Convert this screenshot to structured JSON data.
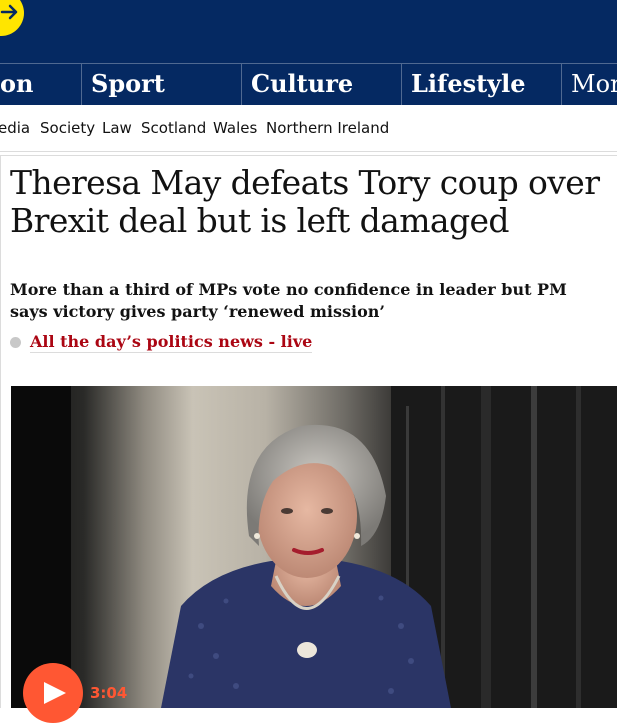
{
  "nav": {
    "pillars": [
      "on",
      "Sport",
      "Culture",
      "Lifestyle",
      "More"
    ],
    "subnav": [
      "edia",
      "Society",
      "Law",
      "Scotland",
      "Wales",
      "Northern Ireland"
    ]
  },
  "article": {
    "headline": "Theresa May defeats Tory coup over Brexit deal but is left damaged",
    "standfirst": "More than a third of MPs vote no confidence in leader but PM says victory gives party ‘renewed mission’",
    "live_link": "All the day’s politics news - live"
  },
  "media": {
    "duration": "3:04"
  },
  "icons": {
    "header_button": "arrow-right-icon",
    "play": "play-icon"
  },
  "colors": {
    "brand_navy": "#052962",
    "accent_yellow": "#ffe500",
    "news_red": "#ab0613",
    "video_orange": "#ff5733"
  }
}
